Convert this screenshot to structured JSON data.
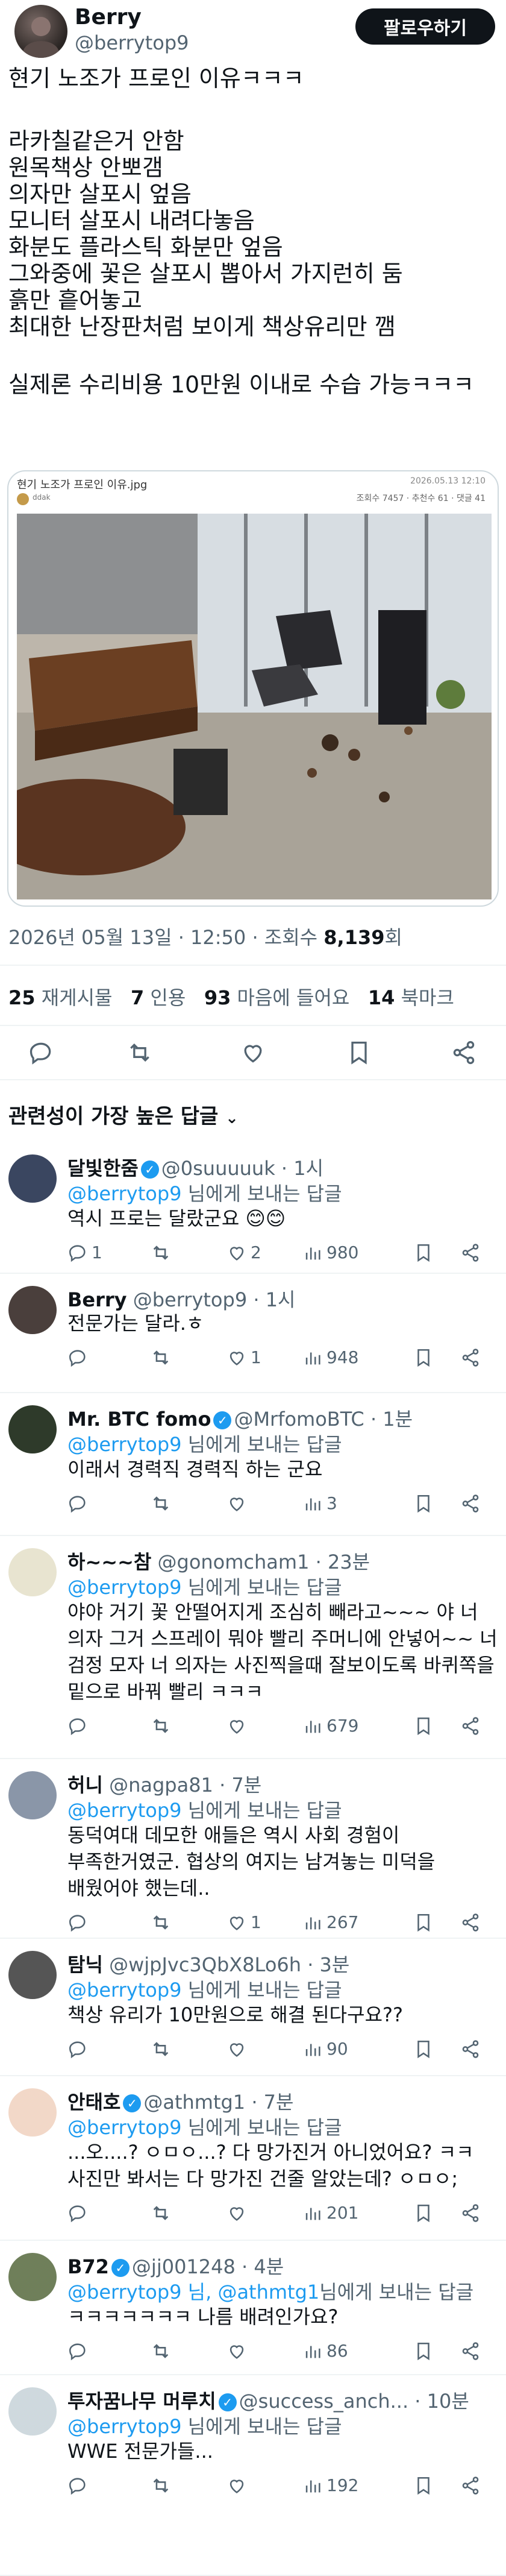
{
  "header": {
    "name": "Berry",
    "handle": "@berrytop9",
    "follow_label": "팔로우하기"
  },
  "post": {
    "lines": [
      "현기 노조가 프로인 이유ㅋㅋㅋ",
      "",
      "라카칠같은거 안함",
      "원목책상 안뽀갬",
      "의자만 살포시 엎음",
      "모니터 살포시 내려다놓음",
      "화분도 플라스틱 화분만 엎음",
      "그와중에 꽃은 살포시 뽑아서 가지런히 둠",
      "흙만 흩어놓고",
      "최대한 난장판처럼 보이게 책상유리만 깸",
      "",
      "실제론 수리비용 10만원 이내로 수습 가능ㅋㅋㅋ"
    ],
    "media": {
      "caption": "현기 노조가 프로인 이유.jpg",
      "date": "2026.05.13 12:10",
      "stats": "조회수 7457 · 추천수 61 · 댓글 41",
      "source": "ddak"
    },
    "meta": {
      "time": "2026년 05월 13일 · 12:50 · 조회수 ",
      "views": "8,139",
      "views_suffix": "회"
    },
    "stats": [
      {
        "num": "25",
        "label": "재게시물"
      },
      {
        "num": "7",
        "label": "인용"
      },
      {
        "num": "93",
        "label": "마음에 들어요"
      },
      {
        "num": "14",
        "label": "북마크"
      }
    ]
  },
  "sort_label": "관련성이 가장 높은 답글",
  "replies": [
    {
      "name": "달빛한줌",
      "verified": true,
      "handle": "@0suuuuuk · 1시",
      "to_prefix": "",
      "to": "@berrytop9",
      "to_suffix": " 님에게 보내는 답글",
      "lines": [
        "역시 프로는 달랐군요 😊😊"
      ],
      "replies": "1",
      "reposts": "",
      "likes": "2",
      "views": "980",
      "avatar_color": "#3a4660"
    },
    {
      "name": "Berry",
      "verified": false,
      "handle": "@berrytop9 · 1시",
      "to_prefix": "",
      "to": "",
      "to_suffix": "",
      "lines": [
        "전문가는 달라.ㅎ"
      ],
      "replies": "",
      "reposts": "",
      "likes": "1",
      "views": "948",
      "avatar_color": "#4a3f3c"
    },
    {
      "name": "Mr. BTC fomo",
      "verified": true,
      "handle": "@MrfomoBTC · 1분",
      "to_prefix": "",
      "to": "@berrytop9",
      "to_suffix": " 님에게 보내는 답글",
      "lines": [
        "이래서 경력직 경력직 하는 군요"
      ],
      "replies": "",
      "reposts": "",
      "likes": "",
      "views": "3",
      "avatar_color": "#2e3a2a"
    },
    {
      "name": "하~~~참",
      "verified": false,
      "handle": "@gonomcham1 · 23분",
      "to_prefix": "",
      "to": "@berrytop9",
      "to_suffix": " 님에게 보내는 답글",
      "lines": [
        "야야 거기  꽃 안떨어지게 조심히 빼라고~~~  야 너",
        "의자 그거 스프레이 뭐야 빨리 주머니에 안넣어~~  너",
        "검정 모자 너 의자는 사진찍을때 잘보이도록 바퀴쪽을",
        "밑으로 바꿔 빨리 ㅋㅋㅋ"
      ],
      "replies": "",
      "reposts": "",
      "likes": "",
      "views": "679",
      "avatar_color": "#e8e4d0"
    },
    {
      "name": "허니",
      "verified": false,
      "handle": "@nagpa81 · 7분",
      "to_prefix": "",
      "to": "@berrytop9",
      "to_suffix": " 님에게 보내는 답글",
      "lines": [
        "동덕여대 데모한 애들은 역시 사회 경험이",
        "부족한거였군. 협상의 여지는 남겨놓는 미덕을",
        "배웠어야 했는데.."
      ],
      "replies": "",
      "reposts": "",
      "likes": "1",
      "views": "267",
      "avatar_color": "#8a96a8"
    },
    {
      "name": "탐닉",
      "verified": false,
      "handle": "@wjpJvc3QbX8Lo6h · 3분",
      "to_prefix": "",
      "to": "@berrytop9",
      "to_suffix": " 님에게 보내는 답글",
      "lines": [
        "책상 유리가 10만원으로 해결 된다구요??"
      ],
      "replies": "",
      "reposts": "",
      "likes": "",
      "views": "90",
      "avatar_color": "#555555"
    },
    {
      "name": "안태호",
      "verified": true,
      "handle": "@athmtg1 · 7분",
      "to_prefix": "",
      "to": "@berrytop9",
      "to_suffix": " 님에게 보내는 답글",
      "lines": [
        "...오....? ㅇㅁㅇ...? 다 망가진거 아니었어요? ㅋㅋ",
        "사진만 봐서는 다 망가진 건줄 알았는데? ㅇㅁㅇ;"
      ],
      "replies": "",
      "reposts": "",
      "likes": "",
      "views": "201",
      "avatar_color": "#f2d8c8"
    },
    {
      "name": "B72",
      "verified": true,
      "handle": "@jj001248 · 4분",
      "to_prefix": "",
      "to": "@berrytop9 님, @athmtg1",
      "to_suffix": "님에게 보내는 답글",
      "lines": [
        "ㅋㅋㅋㅋㅋㅋㅋ 나름 배려인가요?"
      ],
      "replies": "",
      "reposts": "",
      "likes": "",
      "views": "86",
      "avatar_color": "#6f7f5a"
    },
    {
      "name": "투자꿈나무 머루치",
      "verified": true,
      "handle": "@success_anch... · 10분",
      "to_prefix": "",
      "to": "@berrytop9",
      "to_suffix": " 님에게 보내는 답글",
      "lines": [
        "WWE 전문가들..."
      ],
      "replies": "",
      "reposts": "",
      "likes": "",
      "views": "192",
      "avatar_color": "#cfd9de"
    }
  ]
}
